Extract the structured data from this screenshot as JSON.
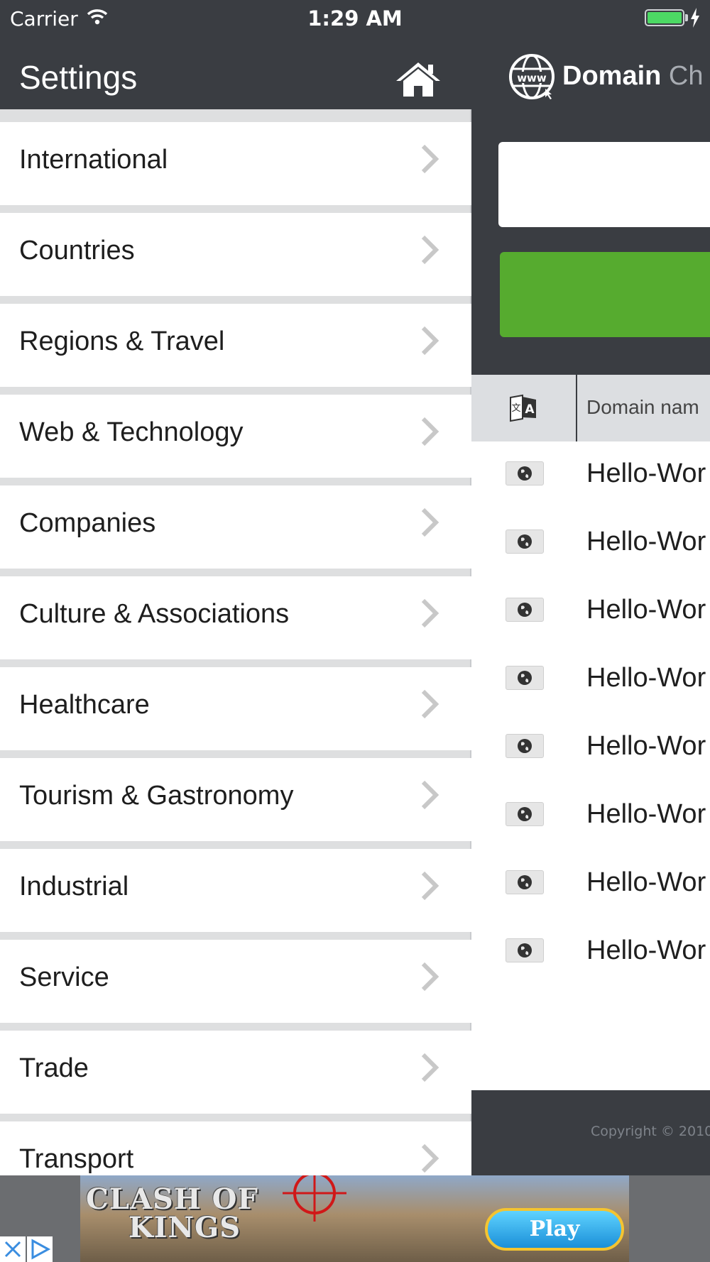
{
  "status_bar": {
    "carrier": "Carrier",
    "time": "1:29 AM"
  },
  "settings": {
    "title": "Settings",
    "items": [
      {
        "label": "International"
      },
      {
        "label": "Countries"
      },
      {
        "label": "Regions & Travel"
      },
      {
        "label": "Web & Technology"
      },
      {
        "label": "Companies"
      },
      {
        "label": "Culture & Associations"
      },
      {
        "label": "Healthcare"
      },
      {
        "label": "Tourism & Gastronomy"
      },
      {
        "label": "Industrial"
      },
      {
        "label": "Service"
      },
      {
        "label": "Trade"
      },
      {
        "label": "Transport"
      }
    ]
  },
  "main": {
    "brand_bold": "Domain",
    "brand_light": "Ch",
    "table_header": "Domain nam",
    "rows": [
      {
        "text": "Hello-Wor"
      },
      {
        "text": "Hello-Wor"
      },
      {
        "text": "Hello-Wor"
      },
      {
        "text": "Hello-Wor"
      },
      {
        "text": "Hello-Wor"
      },
      {
        "text": "Hello-Wor"
      },
      {
        "text": "Hello-Wor"
      },
      {
        "text": "Hello-Wor"
      }
    ],
    "copyright": "Copyright © 2010 -"
  },
  "ad": {
    "logo_line1": "CLASH OF",
    "logo_line2": "KINGS",
    "play_label": "Play"
  },
  "colors": {
    "dark": "#3a3d42",
    "green": "#56ab2f",
    "battery": "#4cd964"
  }
}
